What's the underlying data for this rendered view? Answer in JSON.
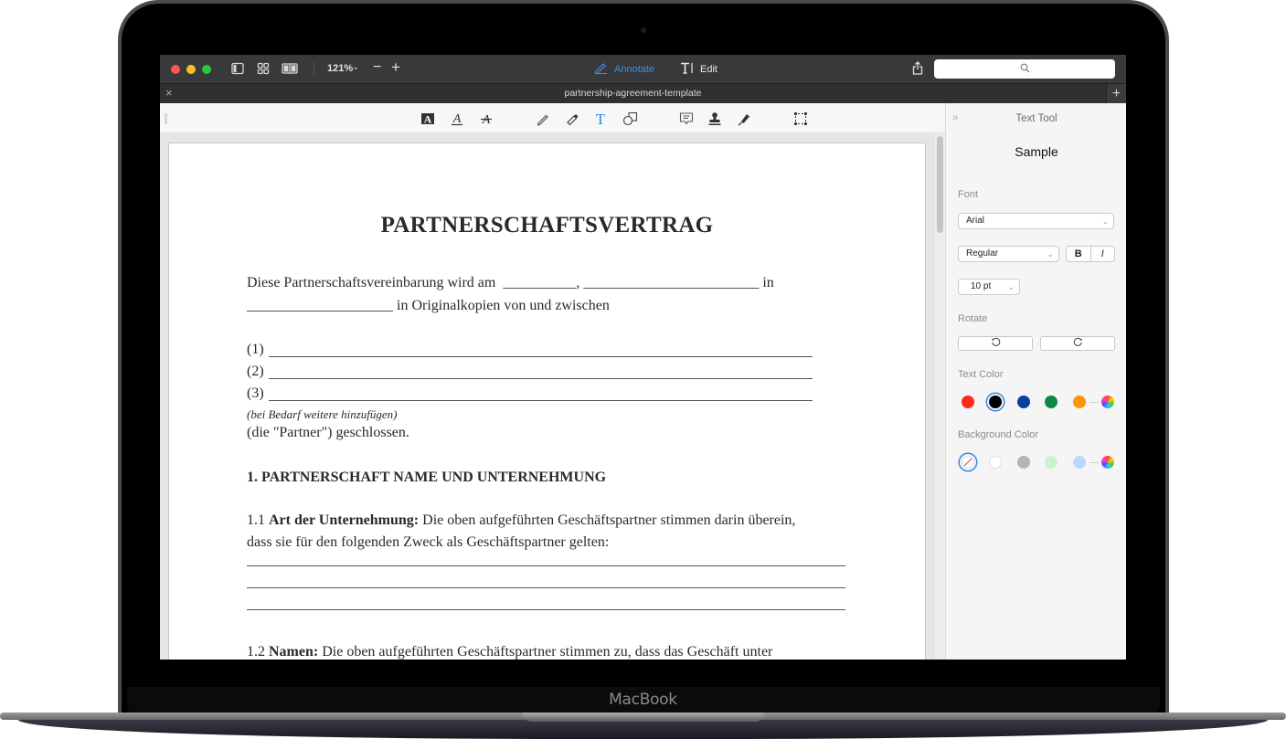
{
  "device": {
    "brand_label": "MacBook"
  },
  "app": {
    "titlebar": {
      "window_controls": [
        "close",
        "minimize",
        "zoom"
      ],
      "view_icons": [
        "sidebar-icon",
        "thumbnails-grid-icon",
        "two-page-icon"
      ],
      "zoom_level": "121%",
      "zoom_out_label": "−",
      "zoom_in_label": "+",
      "modes": [
        {
          "label": "Annotate",
          "icon": "pen-icon",
          "active": true
        },
        {
          "label": "Edit",
          "icon": "text-cursor-icon",
          "active": false
        }
      ],
      "share_icon": "share-icon",
      "search": {
        "placeholder": "",
        "value": "",
        "icon": "search-icon"
      }
    },
    "tab": {
      "title": "partnership-agreement-template",
      "close_label": "×",
      "add_label": "+"
    },
    "annotate_toolbar": {
      "tools": [
        {
          "name": "highlight-text",
          "icon": "highlight-icon"
        },
        {
          "name": "underline-text",
          "icon": "underline-icon"
        },
        {
          "name": "strikethrough-text",
          "icon": "strikethrough-icon"
        },
        {
          "name": "pencil",
          "icon": "pencil-icon"
        },
        {
          "name": "eraser",
          "icon": "eraser-icon"
        },
        {
          "name": "text",
          "icon": "text-tool-icon",
          "active": true
        },
        {
          "name": "shapes",
          "icon": "shapes-icon"
        },
        {
          "name": "note",
          "icon": "note-icon"
        },
        {
          "name": "stamp",
          "icon": "stamp-icon"
        },
        {
          "name": "signature",
          "icon": "signature-pen-icon"
        },
        {
          "name": "selection",
          "icon": "marquee-select-icon"
        }
      ],
      "active_color": "#2f87e5"
    },
    "document": {
      "title": "PARTNERSCHAFTSVERTRAG",
      "intro_line1_text": "Diese Partnerschaftsvereinbarung wird am",
      "intro_line1_blanks": "__________, ________________________",
      "intro_line1_end": "in",
      "intro_line2_blank": "____________________",
      "intro_line2_text": "in Originalkopien von und zwischen",
      "parties": [
        "(1)",
        "(2)",
        "(3)"
      ],
      "parties_note": "(bei Bedarf weitere hinzufügen)",
      "parties_closing": "(die \"Partner\") geschlossen.",
      "section1_heading": "1. PARTNERSCHAFT NAME UND UNTERNEHMUNG",
      "s1_1_number": "1.1",
      "s1_1_label": "Art der Unternehmung:",
      "s1_1_text": "Die oben aufgeführten Geschäftspartner stimmen darin überein,",
      "s1_1_text2": "dass sie für den folgenden Zweck als Geschäftspartner gelten:",
      "s1_2_number": "1.2",
      "s1_2_label": "Namen:",
      "s1_2_text": "Die oben aufgeführten Geschäftspartner stimmen zu, dass das Geschäft unter"
    },
    "text_tool_panel": {
      "collapse_label": "»",
      "title": "Text Tool",
      "sample": "Sample",
      "font_label": "Font",
      "font_value": "Arial",
      "style_value": "Regular",
      "bold_label": "B",
      "italic_label": "I",
      "size_value": "10 pt",
      "rotate_label": "Rotate",
      "rotate_left_icon": "rotate-ccw-icon",
      "rotate_right_icon": "rotate-cw-icon",
      "text_color_label": "Text Color",
      "text_colors": [
        "#ff2a1a",
        "#000000",
        "#0a3fa0",
        "#0a8a44",
        "#ff9408"
      ],
      "text_color_selected": "#000000",
      "background_color_label": "Background Color",
      "background_colors": [
        "none",
        "#ffffff",
        "#b4b4b4",
        "#c8f5cc",
        "#b8d8ff"
      ],
      "background_color_selected": "none"
    }
  }
}
